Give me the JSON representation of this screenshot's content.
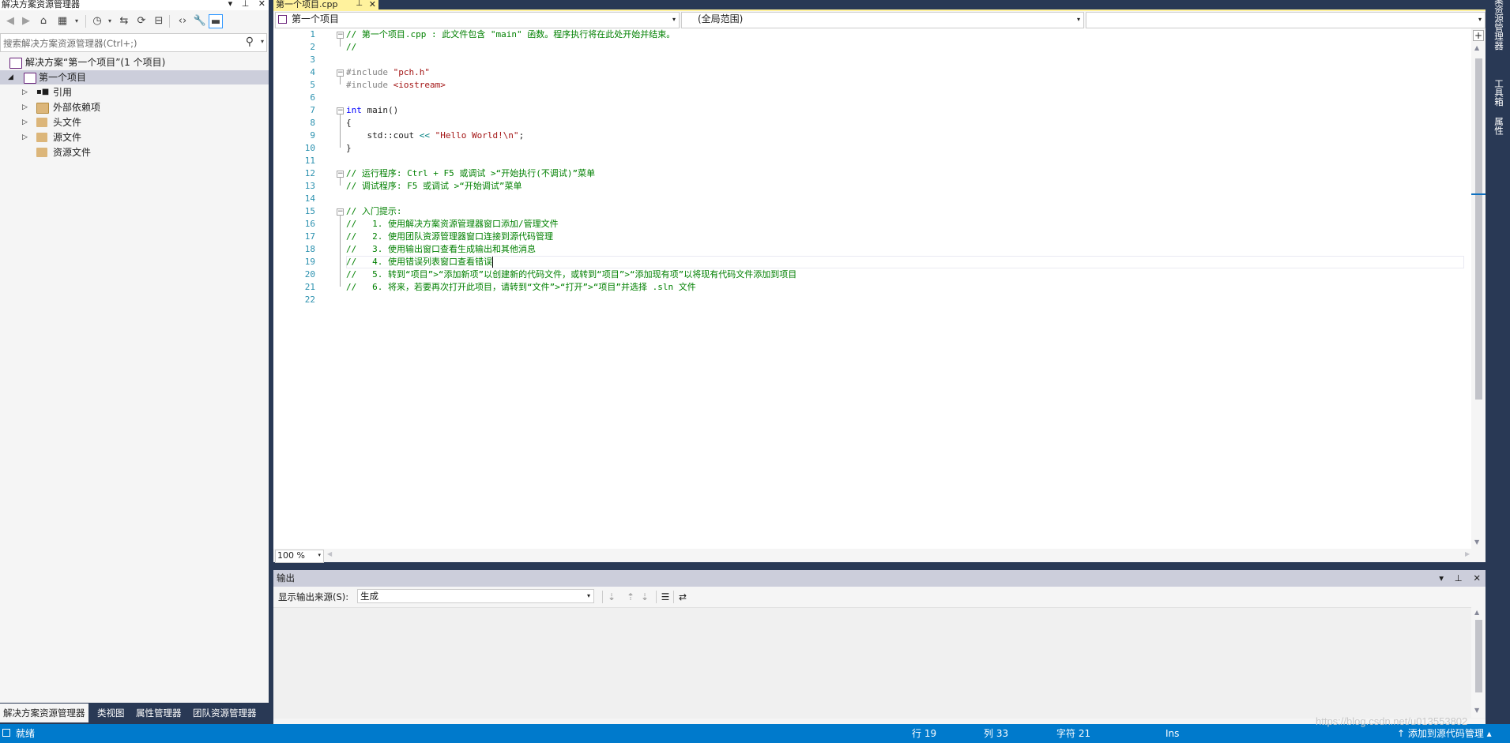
{
  "solution_explorer": {
    "title": "解决方案资源管理器",
    "title_controls": [
      "▾",
      "⊥",
      "✕"
    ],
    "search_placeholder": "搜索解决方案资源管理器(Ctrl+;)",
    "tree": [
      {
        "label": "解决方案“第一个项目”(1 个项目)",
        "icon": "solution-icon"
      },
      {
        "label": "第一个项目",
        "icon": "project-icon",
        "selected": true
      },
      {
        "label": "引用",
        "icon": "references-icon"
      },
      {
        "label": "外部依赖项",
        "icon": "external-deps-icon"
      },
      {
        "label": "头文件",
        "icon": "folder-icon"
      },
      {
        "label": "源文件",
        "icon": "folder-icon"
      },
      {
        "label": "资源文件",
        "icon": "folder-icon"
      }
    ],
    "tabs": [
      "解决方案资源管理器",
      "类视图",
      "属性管理器",
      "团队资源管理器"
    ]
  },
  "editor": {
    "tab_label": "第一个项目.cpp",
    "tab_pin": "⊥",
    "tab_close": "✕",
    "nav_project": "第一个项目",
    "nav_scope": "(全局范围)",
    "nav_member": "",
    "lines": [
      "// 第一个项目.cpp : 此文件包含 \"main\" 函数。程序执行将在此处开始并结束。",
      "//",
      "",
      "#include \"pch.h\"",
      "#include <iostream>",
      "",
      "int main()",
      "{",
      "    std::cout << \"Hello World!\\n\";",
      "}",
      "",
      "// 运行程序: Ctrl + F5 或调试 >“开始执行(不调试)”菜单",
      "// 调试程序: F5 或调试 >“开始调试”菜单",
      "",
      "// 入门提示:",
      "//   1. 使用解决方案资源管理器窗口添加/管理文件",
      "//   2. 使用团队资源管理器窗口连接到源代码管理",
      "//   3. 使用输出窗口查看生成输出和其他消息",
      "//   4. 使用错误列表窗口查看错误",
      "//   5. 转到“项目”>“添加新项”以创建新的代码文件，或转到“项目”>“添加现有项”以将现有代码文件添加到项目",
      "//   6. 将来，若要再次打开此项目，请转到“文件”>“打开”>“项目”并选择 .sln 文件",
      ""
    ],
    "zoom": "100 %"
  },
  "output": {
    "title": "输出",
    "source_label": "显示输出来源(S):",
    "source_value": "生成"
  },
  "right_rail": [
    "解决方案资源管理器",
    "工具箱",
    "属性"
  ],
  "status": {
    "ready": "就绪",
    "line": "行 19",
    "col": "列 33",
    "char": "字符 21",
    "mode": "Ins",
    "source_control": "↑ 添加到源代码管理 ▴"
  },
  "watermark": "https://blog.csdn.net/u013553802"
}
